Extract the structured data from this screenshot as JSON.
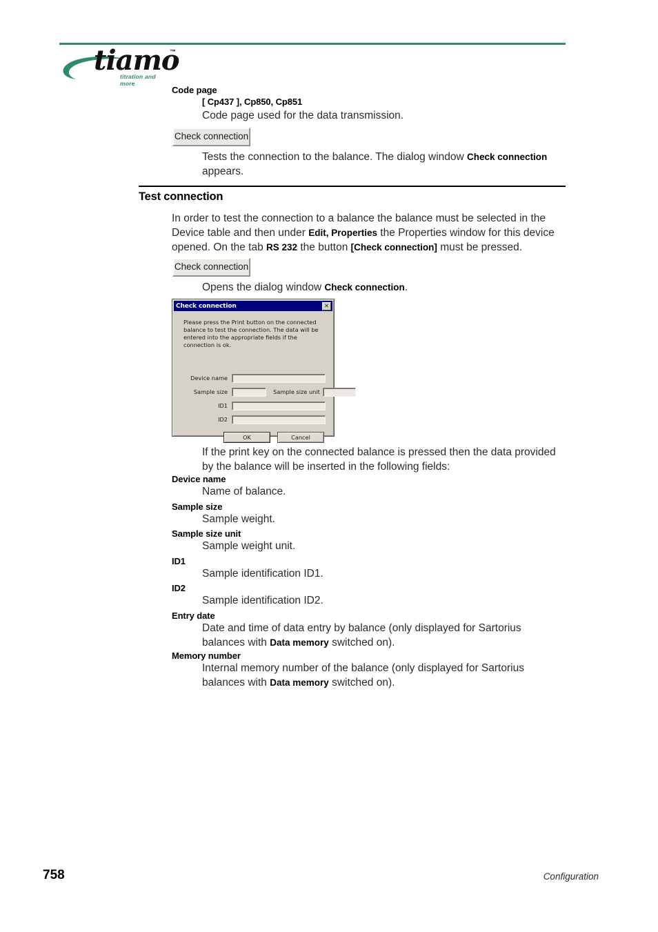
{
  "header": {
    "logo_word": "tiamo",
    "logo_tm": "™",
    "logo_tagline": "titration and more"
  },
  "code_page": {
    "term": "Code page",
    "options": "[ Cp437 ], Cp850, Cp851",
    "description": "Code page used for the data transmission."
  },
  "check_connection_button_1": {
    "label": "Check connection",
    "description_before": "Tests the connection to the balance. The dialog window ",
    "description_bold": "Check connection",
    "description_after": " appears."
  },
  "section": {
    "title": "Test connection",
    "intro_1": "In order to test the connection to a balance the balance must be selected in the Device table and then under ",
    "intro_bold_1": "Edit, Properties",
    "intro_2": " the Properties window for this device opened. On the tab ",
    "intro_bold_2": "RS 232",
    "intro_3": " the button ",
    "intro_bold_3": "[Check connection]",
    "intro_4": " must be pressed."
  },
  "check_connection_button_2": {
    "label": "Check connection",
    "description_before": "Opens the dialog window ",
    "description_bold": "Check connection",
    "description_after": "."
  },
  "dialog": {
    "title": "Check connection",
    "close_glyph": "✕",
    "close_icon_name": "close-icon",
    "instructions": "Please press the Print button on the connected balance to test the connection. The data will be entered into the appropriate fields if the connection is ok.",
    "fields": [
      {
        "label": "Device name",
        "value": ""
      },
      {
        "label": "Sample size",
        "value": ""
      },
      {
        "label": "Sample size unit",
        "value": ""
      },
      {
        "label": "ID1",
        "value": ""
      },
      {
        "label": "ID2",
        "value": ""
      }
    ],
    "buttons": {
      "ok": "OK",
      "cancel": "Cancel"
    }
  },
  "after_dialog_text": "If the print key on the connected balance is pressed then the data provided by the balance will be inserted in the following fields:",
  "definitions": [
    {
      "term": "Device name",
      "desc_1": "Name of balance.",
      "desc_bold": "",
      "desc_2": ""
    },
    {
      "term": "Sample size",
      "desc_1": "Sample weight.",
      "desc_bold": "",
      "desc_2": ""
    },
    {
      "term": "Sample size unit",
      "desc_1": "Sample weight unit.",
      "desc_bold": "",
      "desc_2": ""
    },
    {
      "term": "ID1",
      "desc_1": "Sample identification ID1.",
      "desc_bold": "",
      "desc_2": ""
    },
    {
      "term": "ID2",
      "desc_1": "Sample identification ID2.",
      "desc_bold": "",
      "desc_2": ""
    },
    {
      "term": "Entry date",
      "desc_1": "Date and time of data entry by balance (only displayed for Sartorius balances with ",
      "desc_bold": "Data memory",
      "desc_2": " switched on)."
    },
    {
      "term": "Memory number",
      "desc_1": "Internal memory number of the balance (only displayed for Sartorius balances with ",
      "desc_bold": "Data memory",
      "desc_2": " switched on)."
    }
  ],
  "footer": {
    "page_number": "758",
    "chapter": "Configuration"
  },
  "colors": {
    "brand_green": "#2e8b6f",
    "title_bar_blue": "#000082",
    "dialog_face": "#d6d2c8"
  }
}
